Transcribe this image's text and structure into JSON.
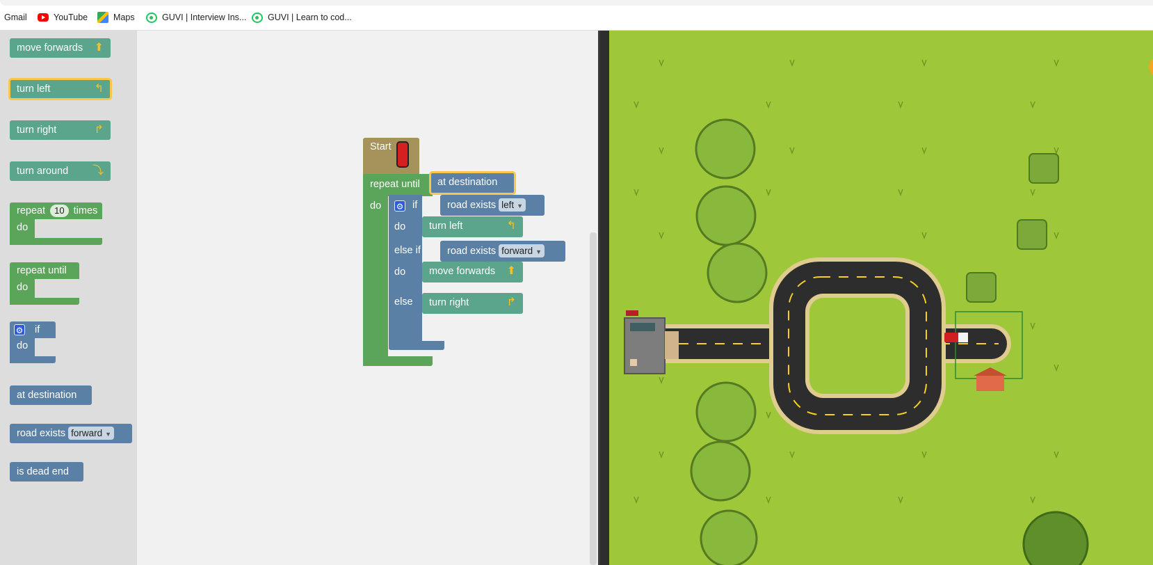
{
  "bookmarks": [
    {
      "label": "Gmail",
      "icon": "gmail-icon"
    },
    {
      "label": "YouTube",
      "icon": "youtube-icon"
    },
    {
      "label": "Maps",
      "icon": "maps-icon"
    },
    {
      "label": "GUVI | Interview Ins...",
      "icon": "guvi-icon"
    },
    {
      "label": "GUVI | Learn to cod...",
      "icon": "guvi-icon"
    }
  ],
  "toolbox": {
    "move_forwards": "move forwards",
    "turn_left": "turn left",
    "turn_right": "turn right",
    "turn_around": "turn around",
    "repeat_label": "repeat",
    "repeat_count": "10",
    "repeat_times": "times",
    "do": "do",
    "repeat_until": "repeat until",
    "if": "if",
    "at_destination": "at destination",
    "road_exists": "road exists",
    "road_exists_option": "forward",
    "is_dead_end": "is dead end"
  },
  "program": {
    "start": "Start",
    "repeat_until": "repeat until",
    "condition": "at destination",
    "do": "do",
    "if": "if",
    "road_exists": "road exists",
    "if_option": "left",
    "if_do_action": "turn left",
    "else_if": "else if",
    "else_if_option": "forward",
    "else_if_do_action": "move forwards",
    "else": "else",
    "else_action": "turn right"
  },
  "colors": {
    "motion_block": "#5ba58c",
    "logic_block": "#5b80a5",
    "loop_block": "#5ba55b",
    "start_block": "#a5935b",
    "selected_outline": "#f7c64a",
    "grass": "#9ec83a",
    "road": "#2d2d2d",
    "road_line": "#f5d020"
  }
}
